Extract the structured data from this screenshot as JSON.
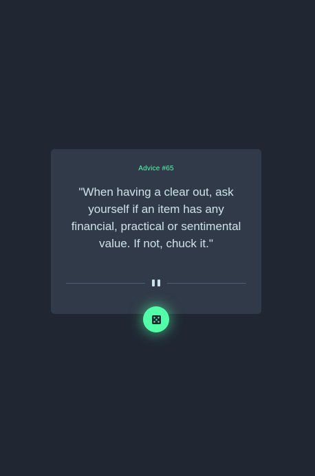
{
  "advice": {
    "id_label": "Advice #65",
    "quote": "\"When having a clear out, ask yourself if an item has any financial, practical or sentimental value. If not, chuck it.\""
  },
  "divider": {
    "icon": "pause-icon"
  },
  "dice_button": {
    "icon": "dice-icon"
  },
  "colors": {
    "background": "#202733",
    "card": "#313A48",
    "accent": "#52FFA8",
    "text": "#CEE3E9",
    "divider": "#4F5D74"
  }
}
